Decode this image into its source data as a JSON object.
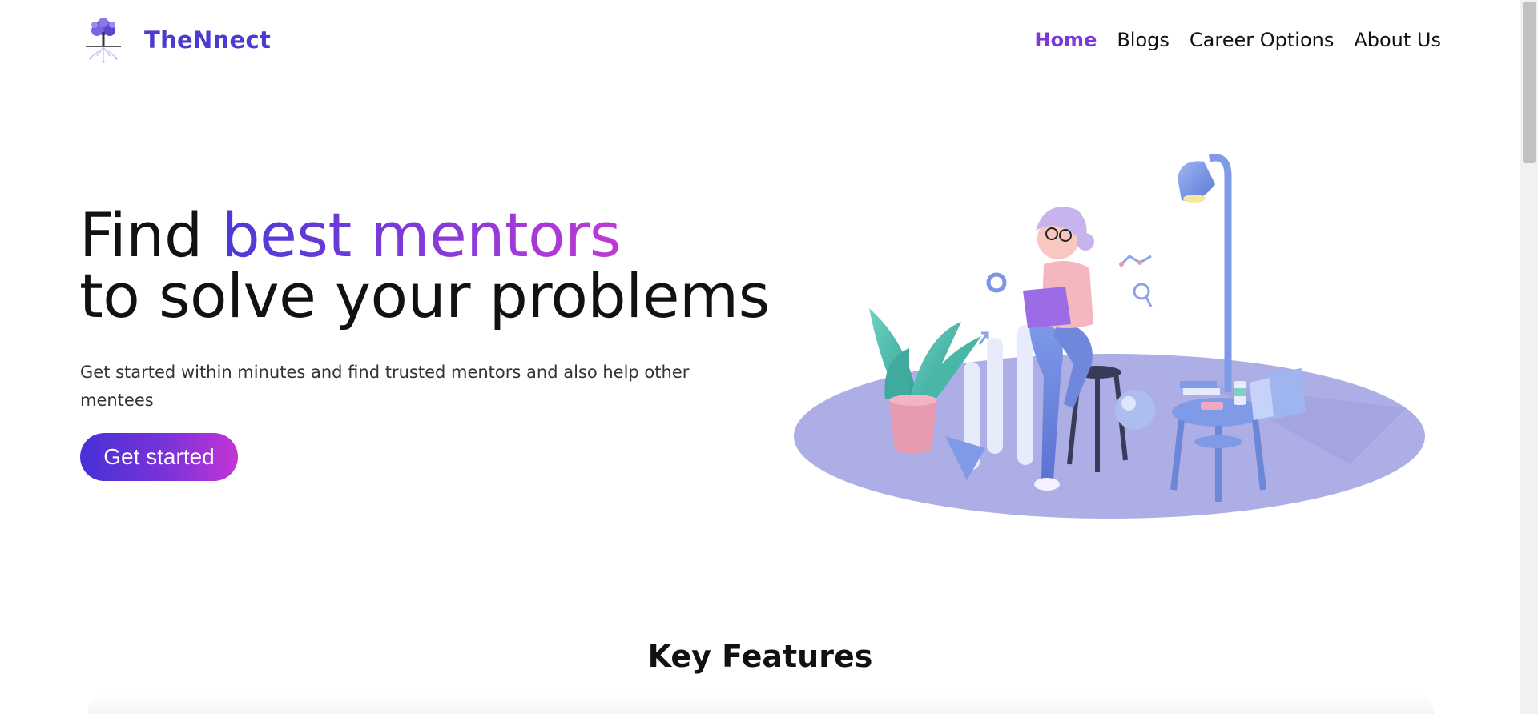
{
  "brand": {
    "name": "TheNnect",
    "logo_icon": "tree-logo-icon"
  },
  "nav": [
    {
      "label": "Home",
      "active": true
    },
    {
      "label": "Blogs",
      "active": false
    },
    {
      "label": "Career Options",
      "active": false
    },
    {
      "label": "About Us",
      "active": false
    }
  ],
  "hero": {
    "title_line1_prefix": "Find ",
    "title_line1_highlight": "best mentors",
    "title_line2": "to solve your problems",
    "subtitle": "Get started within minutes and find trusted mentors and also help other mentees",
    "cta_label": "Get started"
  },
  "key_features": {
    "title": "Key Features"
  },
  "colors": {
    "brand": "#4b3bd0",
    "nav_active": "#7a3ad8",
    "gradient_start": "#4830d8",
    "gradient_end": "#c334d6",
    "platform": "#aeaee6"
  }
}
